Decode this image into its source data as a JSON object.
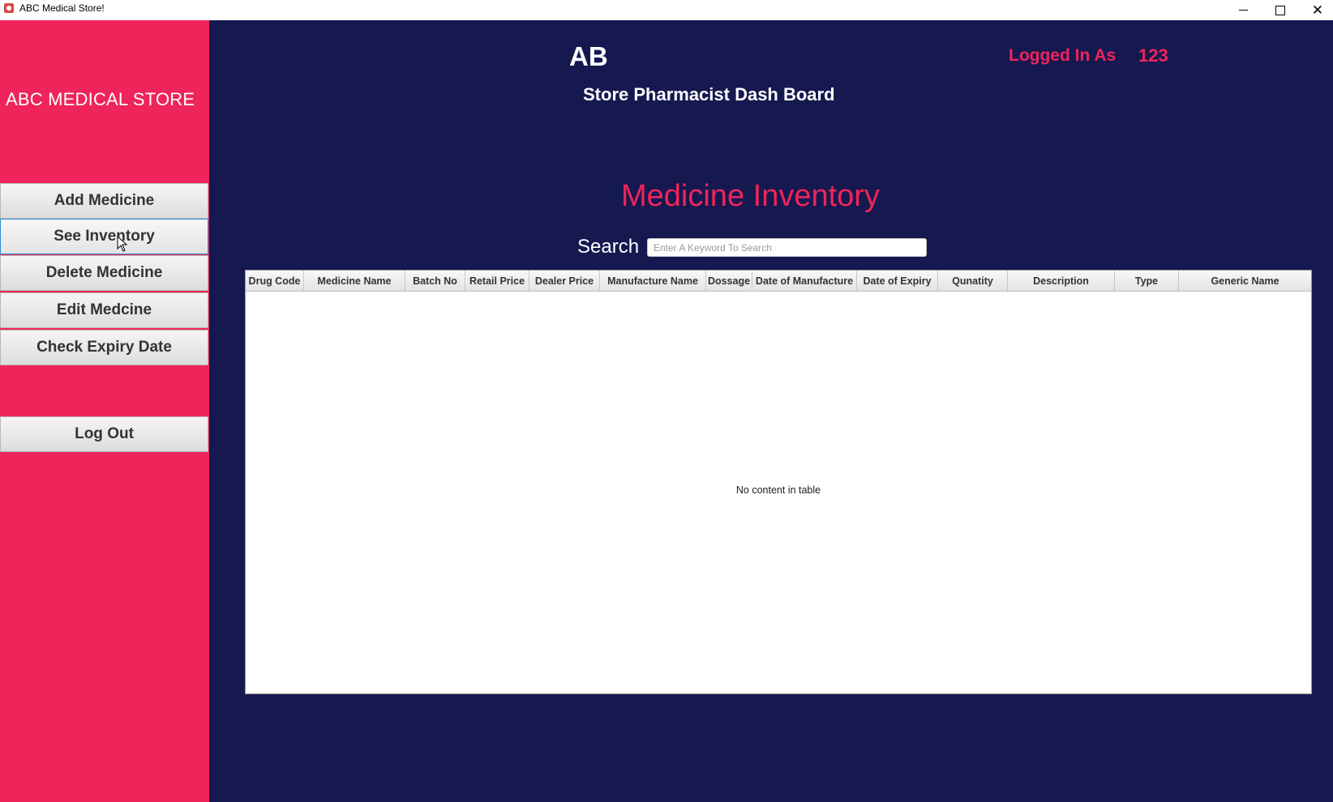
{
  "window": {
    "title": "ABC Medical Store!"
  },
  "sidebar": {
    "brand": "ABC MEDICAL STORE",
    "items": [
      {
        "label": "Add Medicine"
      },
      {
        "label": "See Inventory"
      },
      {
        "label": "Delete Medicine"
      },
      {
        "label": "Edit Medcine"
      },
      {
        "label": "Check Expiry Date"
      }
    ],
    "logout_label": "Log Out"
  },
  "header": {
    "logo_text": "AB",
    "subtitle": "Store Pharmacist Dash Board",
    "logged_in_label": "Logged In As",
    "logged_in_user": "123"
  },
  "main": {
    "section_title": "Medicine Inventory",
    "search_label": "Search",
    "search_placeholder": "Enter A Keyword To Search",
    "search_value": "",
    "table": {
      "columns": [
        "Drug Code",
        "Medicine Name",
        "Batch No",
        "Retail Price",
        "Dealer Price",
        "Manufacture Name",
        "Dossage",
        "Date of Manufacture",
        "Date of Expiry",
        "Qunatity",
        "Description",
        "Type",
        "Generic Name"
      ],
      "rows": [],
      "empty_message": "No content in table"
    }
  },
  "colors": {
    "sidebar": "#ef245a",
    "main_bg": "#161850",
    "accent": "#ef245a"
  },
  "icons": {
    "app": "app-icon",
    "minimize": "minimize-icon",
    "maximize": "maximize-icon",
    "close": "close-icon",
    "cursor": "mouse-cursor-icon"
  }
}
